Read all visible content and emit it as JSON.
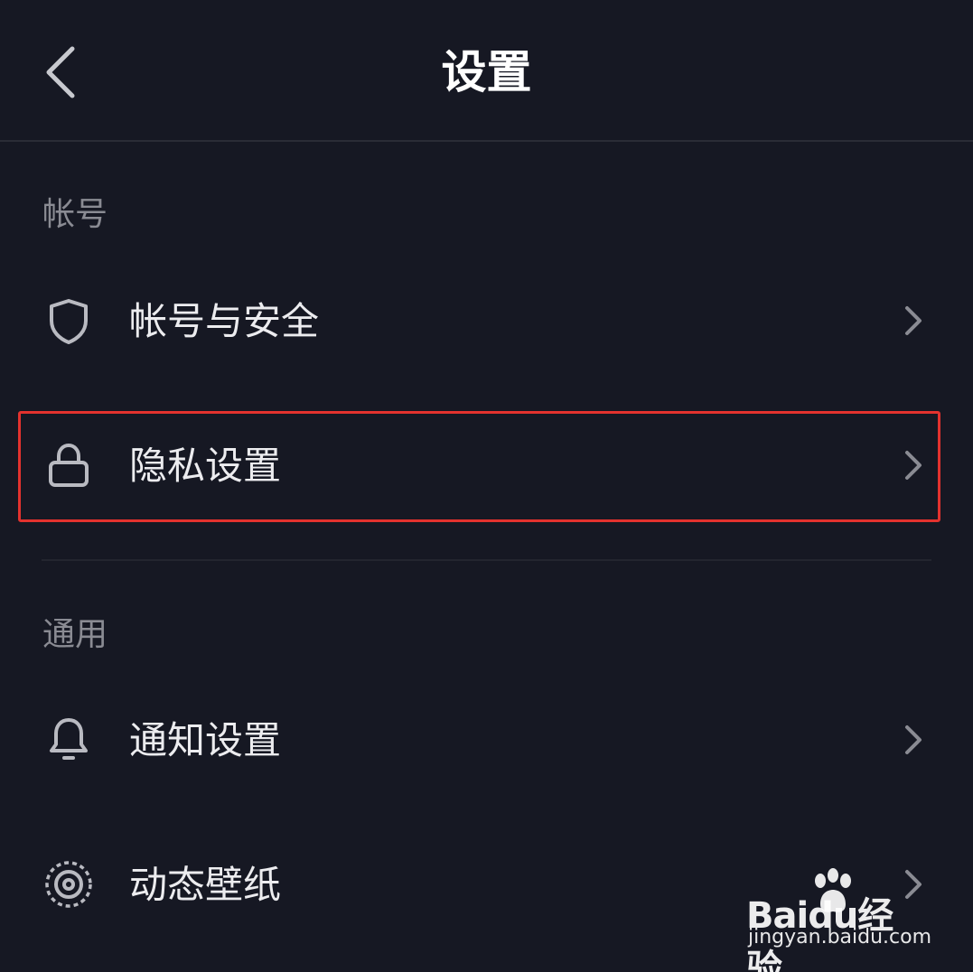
{
  "header": {
    "title": "设置",
    "back_icon": "chevron-left-icon"
  },
  "sections": [
    {
      "label": "帐号",
      "items": [
        {
          "label": "帐号与安全",
          "icon": "shield-icon"
        },
        {
          "label": "隐私设置",
          "icon": "lock-icon",
          "highlighted": true
        }
      ]
    },
    {
      "label": "通用",
      "items": [
        {
          "label": "通知设置",
          "icon": "bell-icon"
        },
        {
          "label": "动态壁纸",
          "icon": "live-wallpaper-icon"
        }
      ]
    }
  ],
  "colors": {
    "background": "#161823",
    "highlight_border": "#e3322e",
    "text_primary": "#ececef",
    "text_secondary": "#8a8b93"
  },
  "watermark": {
    "logo_text": "Baidu经验",
    "url": "jingyan.baidu.com"
  }
}
